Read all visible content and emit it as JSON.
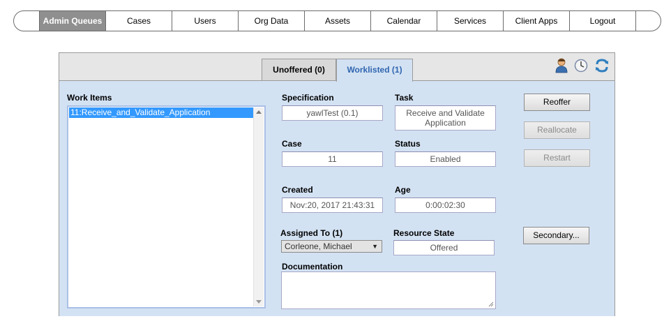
{
  "nav": {
    "items": [
      "Admin Queues",
      "Cases",
      "Users",
      "Org Data",
      "Assets",
      "Calendar",
      "Services",
      "Client Apps",
      "Logout"
    ],
    "active": "Admin Queues"
  },
  "tabs": {
    "unoffered": "Unoffered (0)",
    "worklisted": "Worklisted (1)"
  },
  "header_icons": [
    "user-icon",
    "clock-icon",
    "refresh-icon"
  ],
  "work_items": {
    "label": "Work Items",
    "items": [
      "11:Receive_and_Validate_Application"
    ]
  },
  "details": {
    "specification_label": "Specification",
    "specification": "yawlTest (0.1)",
    "task_label": "Task",
    "task": "Receive and Validate Application",
    "case_label": "Case",
    "case": "11",
    "status_label": "Status",
    "status": "Enabled",
    "created_label": "Created",
    "created": "Nov:20, 2017 21:43:31",
    "age_label": "Age",
    "age": "0:00:02:30",
    "assigned_label": "Assigned To (1)",
    "assigned": "Corleone, Michael",
    "resource_state_label": "Resource State",
    "resource_state": "Offered",
    "documentation_label": "Documentation",
    "documentation": ""
  },
  "buttons": {
    "reoffer": "Reoffer",
    "reallocate": "Reallocate",
    "restart": "Restart",
    "secondary": "Secondary..."
  },
  "colors": {
    "panel_bg": "#d3e2f3",
    "active_tab_text": "#3065b0",
    "nav_active_bg": "#8f8f8f",
    "selection": "#3399ff"
  }
}
